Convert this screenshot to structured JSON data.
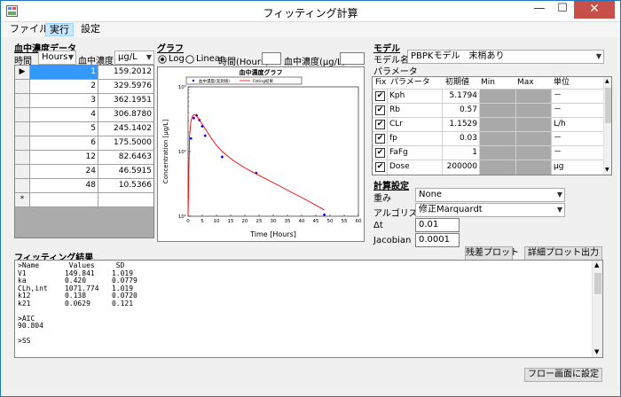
{
  "window": {
    "title": "フィッティング計算",
    "icon": "app-icon",
    "min": "—",
    "max": "☐",
    "close": "✕"
  },
  "menu": {
    "items": [
      "ファイル",
      "実行",
      "設定"
    ],
    "active_index": 1
  },
  "data_section": {
    "title": "血中濃度データ",
    "time_label": "時間",
    "time_unit": "Hours",
    "conc_label": "血中濃度",
    "conc_unit": "μg/L",
    "rows": [
      {
        "time": "1",
        "conc": "159.2012"
      },
      {
        "time": "2",
        "conc": "329.5976"
      },
      {
        "time": "3",
        "conc": "362.1951"
      },
      {
        "time": "4",
        "conc": "306.8780"
      },
      {
        "time": "5",
        "conc": "245.1402"
      },
      {
        "time": "6",
        "conc": "175.5000"
      },
      {
        "time": "12",
        "conc": "82.6463"
      },
      {
        "time": "24",
        "conc": "46.5915"
      },
      {
        "time": "48",
        "conc": "10.5366"
      }
    ],
    "new_row_marker": "*",
    "current_row_marker": "▶"
  },
  "graph_section": {
    "title": "グラフ",
    "log_label": "Log",
    "linear_label": "Linear",
    "scale_selected": "Log",
    "time_axis_label": "時間(Hours)",
    "conc_axis_label": "血中濃度(μg/L)"
  },
  "chart_data": {
    "type": "scatter",
    "title": "血中濃度グラフ",
    "xlabel": "Time [Hours]",
    "ylabel": "Concentration [μg/L]",
    "xlim": [
      0,
      60
    ],
    "ylim": [
      10,
      1000
    ],
    "yscale": "log",
    "xticks": [
      "0",
      "5",
      "10",
      "15",
      "20",
      "25",
      "30",
      "35",
      "40",
      "45",
      "50",
      "55",
      "60"
    ],
    "yticks": [
      "10³",
      "10²",
      "10¹"
    ],
    "legend": [
      "血中濃度(実測値)",
      "Fitting結果"
    ],
    "legend_placement": "top",
    "series": [
      {
        "name": "血中濃度(実測値)",
        "kind": "points",
        "color": "#0000ff",
        "x": [
          1,
          2,
          3,
          4,
          5,
          6,
          12,
          24,
          48
        ],
        "y": [
          159.2012,
          329.5976,
          362.1951,
          306.878,
          245.1402,
          175.5,
          82.6463,
          46.5915,
          10.5366
        ]
      },
      {
        "name": "Fitting結果",
        "kind": "line",
        "color": "#ff0000",
        "x": [
          0,
          0.5,
          1,
          1.5,
          2,
          2.5,
          3,
          4,
          5,
          6,
          8,
          10,
          12,
          16,
          20,
          24,
          30,
          36,
          42,
          48
        ],
        "y": [
          10,
          170,
          290,
          350,
          370,
          365,
          350,
          310,
          265,
          225,
          165,
          125,
          100,
          72,
          56,
          45,
          33,
          24,
          17.5,
          12.5
        ]
      }
    ]
  },
  "model_section": {
    "title": "モデル",
    "model_name_label": "モデル名",
    "model_name": "PBPKモデル　末梢あり",
    "params_label": "パラメータ",
    "columns": [
      "Fix",
      "パラメータ",
      "初期値",
      "Min",
      "Max",
      "単位"
    ],
    "params": [
      {
        "fixed": true,
        "name": "Kph",
        "init": "5.1794",
        "unit": "－"
      },
      {
        "fixed": true,
        "name": "Rb",
        "init": "0.57",
        "unit": "－"
      },
      {
        "fixed": true,
        "name": "CLr",
        "init": "1.1529",
        "unit": "L/h"
      },
      {
        "fixed": true,
        "name": "fp",
        "init": "0.03",
        "unit": "－"
      },
      {
        "fixed": true,
        "name": "FaFg",
        "init": "1",
        "unit": "－"
      },
      {
        "fixed": true,
        "name": "Dose",
        "init": "200000",
        "unit": "μg"
      }
    ]
  },
  "calc_section": {
    "title": "計算設定",
    "weight_label": "重み",
    "weight_value": "None",
    "algo_label": "アルゴリズム",
    "algo_value": "修正Marquardt",
    "dt_label": "Δt",
    "dt_value": "0.01",
    "jacobian_label": "Jacobian",
    "jacobian_value": "0.0001"
  },
  "buttons": {
    "residual_plot": "残差プロット",
    "detail_plot": "詳細プロット出力",
    "flow_setting": "フロー画面に設定"
  },
  "results_section": {
    "title": "フィッティング結果",
    "text": ">Name       Values     SD\nV1         149.841    1.019\nka         0.420      0.0779\nCLh,int    1071.774   1.019\nk12        0.138      0.0720\nk21        0.0629     0.121\n\n>AIC\n90.804\n\n>SS"
  }
}
